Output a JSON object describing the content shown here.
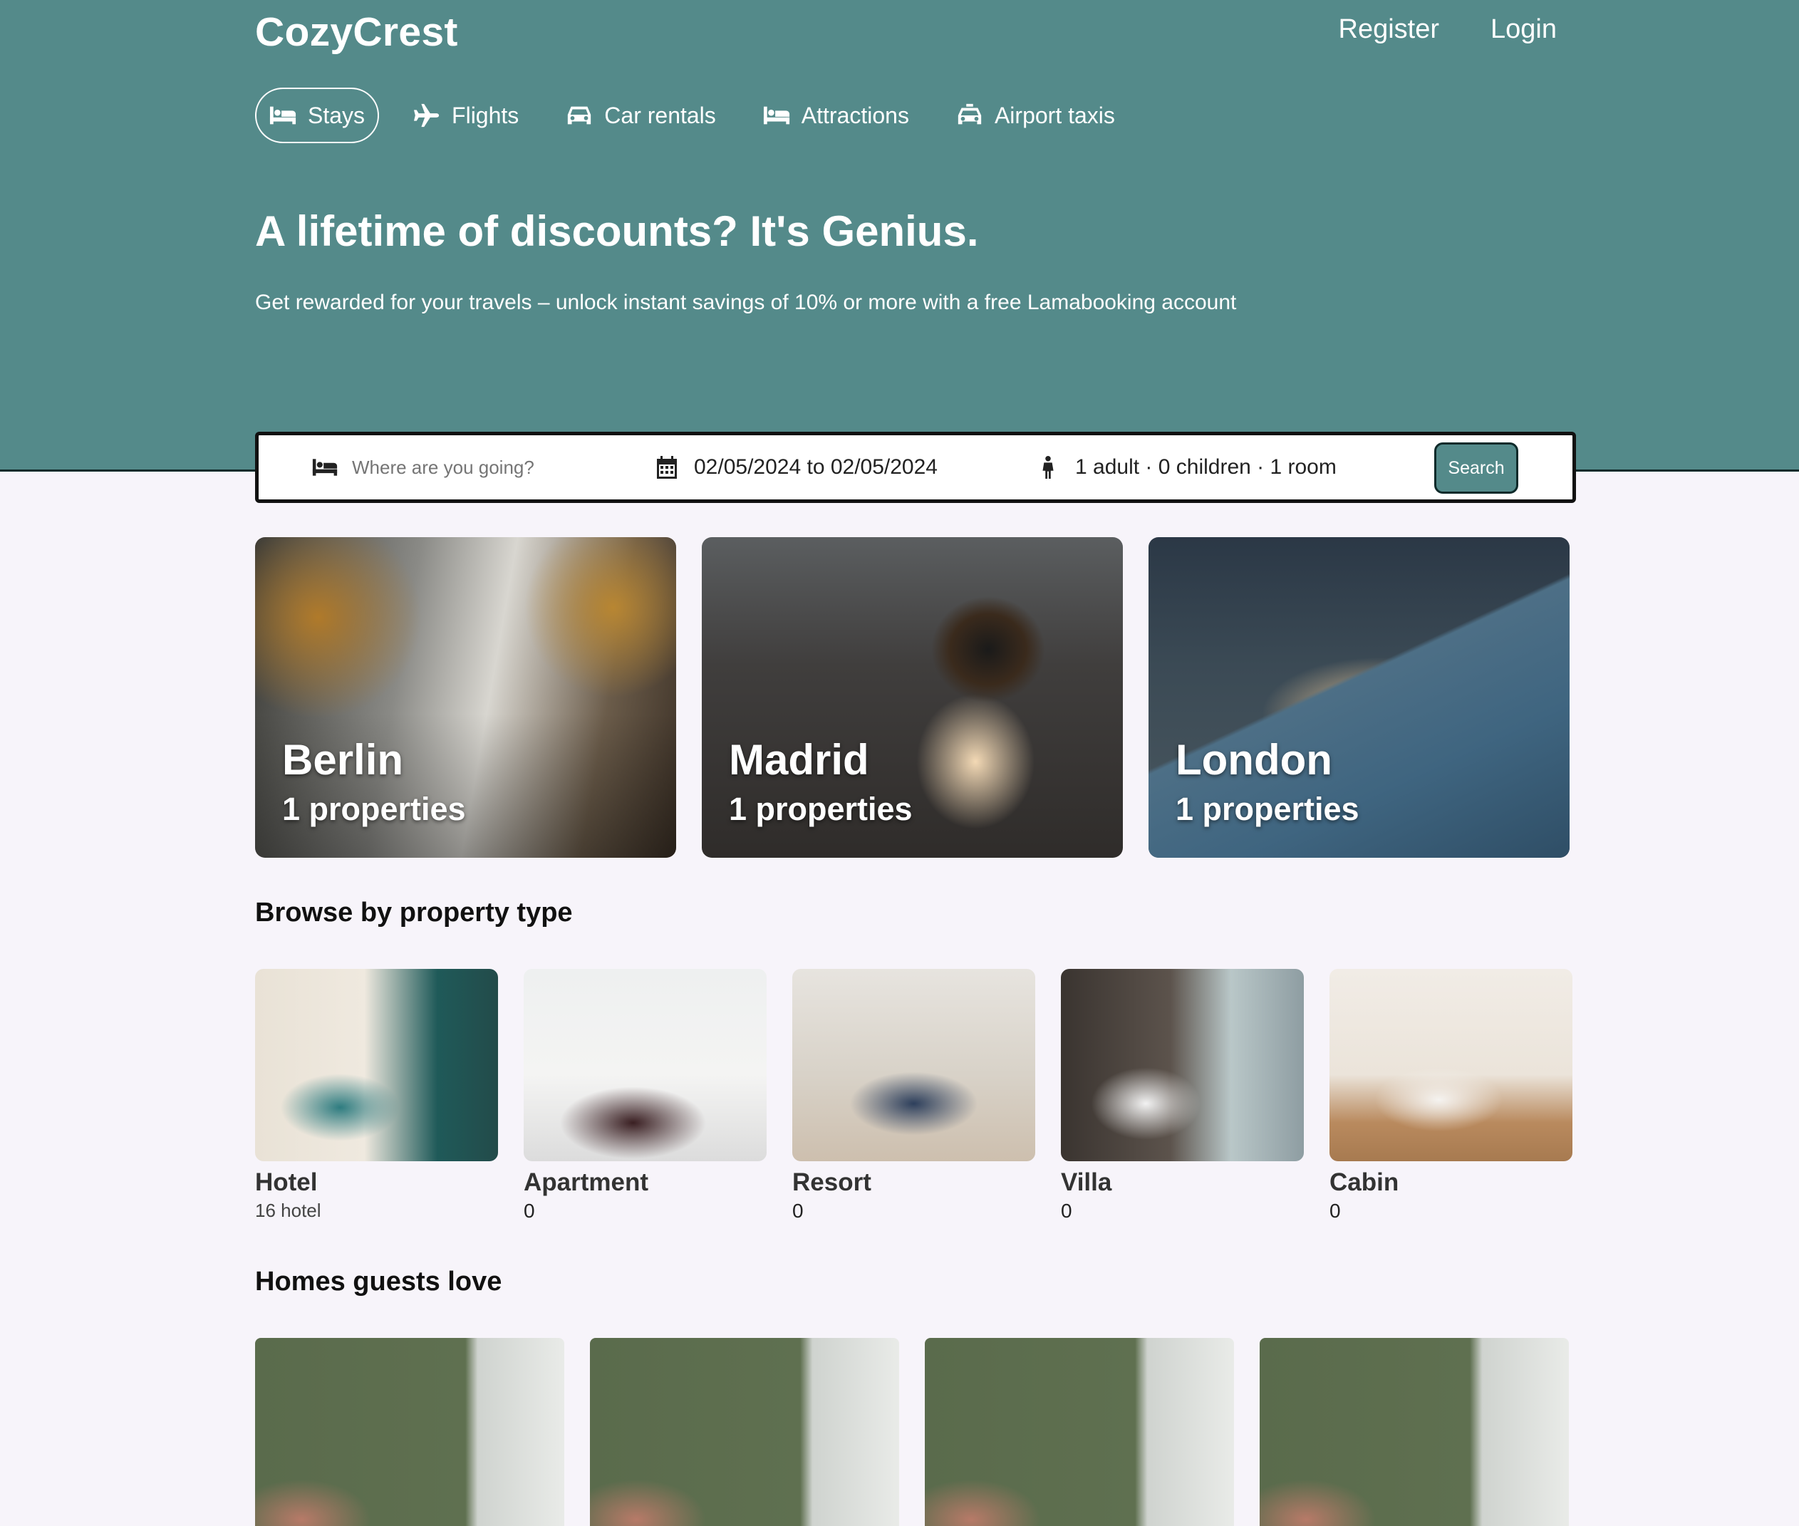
{
  "header": {
    "brand": "CozyCrest",
    "register_label": "Register",
    "login_label": "Login"
  },
  "nav": {
    "items": [
      {
        "label": "Stays",
        "icon": "bed-icon",
        "active": true
      },
      {
        "label": "Flights",
        "icon": "plane-icon",
        "active": false
      },
      {
        "label": "Car rentals",
        "icon": "car-icon",
        "active": false
      },
      {
        "label": "Attractions",
        "icon": "bed-icon",
        "active": false
      },
      {
        "label": "Airport taxis",
        "icon": "taxi-icon",
        "active": false
      }
    ]
  },
  "hero": {
    "title": "A lifetime of discounts? It's Genius.",
    "subtitle": "Get rewarded for your travels – unlock instant savings of 10% or more with a free Lamabooking account"
  },
  "search": {
    "destination_placeholder": "Where are you going?",
    "dates": "02/05/2024 to 02/05/2024",
    "guests": "1 adult · 0 children · 1 room",
    "button_label": "Search"
  },
  "featured": [
    {
      "city": "Berlin",
      "count": "1 properties"
    },
    {
      "city": "Madrid",
      "count": "1 properties"
    },
    {
      "city": "London",
      "count": "1 properties"
    }
  ],
  "browse": {
    "title": "Browse by property type",
    "types": [
      {
        "name": "Hotel",
        "count": "16 hotel"
      },
      {
        "name": "Apartment",
        "count": "0"
      },
      {
        "name": "Resort",
        "count": "0"
      },
      {
        "name": "Villa",
        "count": "0"
      },
      {
        "name": "Cabin",
        "count": "0"
      }
    ]
  },
  "homes": {
    "title": "Homes guests love"
  },
  "colors": {
    "brand": "#548a8a",
    "background": "#f7f4fa",
    "border_dark": "#0e2a2a"
  }
}
